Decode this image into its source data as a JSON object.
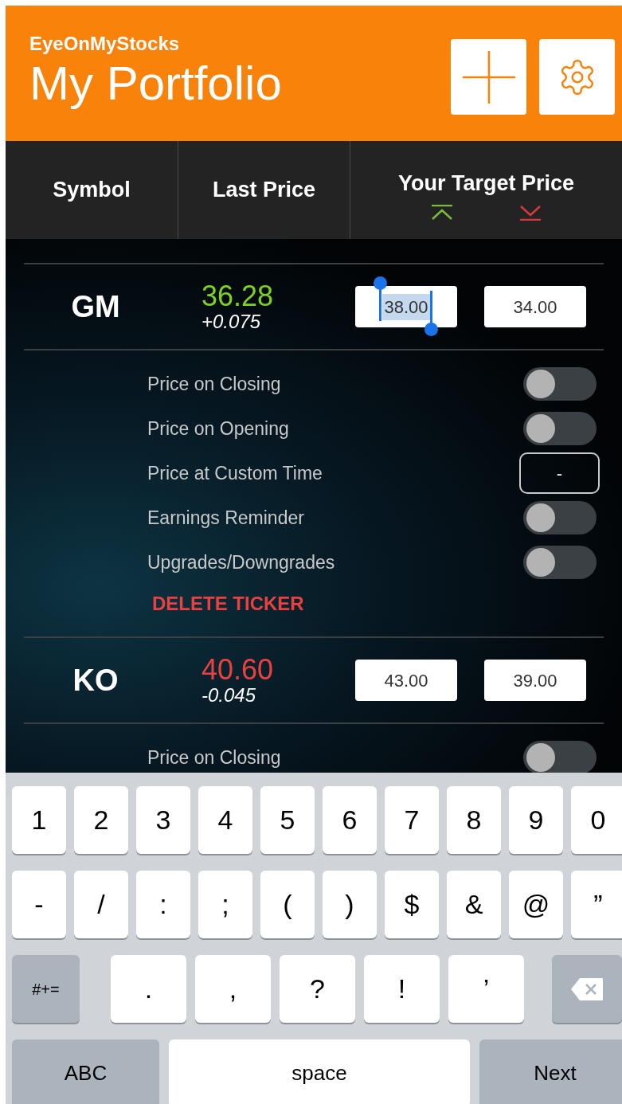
{
  "header": {
    "app_name": "EyeOnMyStocks",
    "title": "My Portfolio"
  },
  "columns": [
    {
      "label": "Symbol"
    },
    {
      "label": "Last Price"
    },
    {
      "label": "Your Target Price"
    }
  ],
  "stocks": [
    {
      "symbol": "GM",
      "price": "36.28",
      "change": "+0.075",
      "color": "#7ed321",
      "targets": [
        {
          "value": "38.00",
          "selected": true
        },
        {
          "value": "34.00",
          "selected": false
        }
      ],
      "options": [
        {
          "kind": "toggle",
          "label": "Price on Closing",
          "on": false
        },
        {
          "kind": "toggle",
          "label": "Price on Opening",
          "on": false
        },
        {
          "kind": "time",
          "label": "Price at Custom Time",
          "value": "-"
        },
        {
          "kind": "toggle",
          "label": "Earnings Reminder",
          "on": false
        },
        {
          "kind": "toggle",
          "label": "Upgrades/Downgrades",
          "on": false
        }
      ],
      "delete_label": "DELETE TICKER"
    },
    {
      "symbol": "KO",
      "price": "40.60",
      "change": "-0.045",
      "color": "#e8413f",
      "targets": [
        {
          "value": "43.00",
          "selected": false
        },
        {
          "value": "39.00",
          "selected": false
        }
      ],
      "options": [
        {
          "kind": "toggle",
          "label": "Price on Closing",
          "on": false
        }
      ]
    }
  ],
  "keyboard": {
    "number_keys": [
      {
        "kind": "char",
        "label": "1"
      },
      {
        "kind": "char",
        "label": "2"
      },
      {
        "kind": "char",
        "label": "3"
      },
      {
        "kind": "char",
        "label": "4"
      },
      {
        "kind": "char",
        "label": "5"
      },
      {
        "kind": "char",
        "label": "6"
      },
      {
        "kind": "char",
        "label": "7"
      },
      {
        "kind": "char",
        "label": "8"
      },
      {
        "kind": "char",
        "label": "9"
      },
      {
        "kind": "char",
        "label": "0"
      }
    ],
    "symbol_keys": [
      {
        "kind": "char",
        "label": "-"
      },
      {
        "kind": "char",
        "label": "/"
      },
      {
        "kind": "char",
        "label": ":"
      },
      {
        "kind": "char",
        "label": ";"
      },
      {
        "kind": "char",
        "label": "("
      },
      {
        "kind": "char",
        "label": ")"
      },
      {
        "kind": "char",
        "label": "$"
      },
      {
        "kind": "char",
        "label": "&"
      },
      {
        "kind": "char",
        "label": "@"
      },
      {
        "kind": "char",
        "label": "”"
      }
    ],
    "punctuation_keys": [
      {
        "kind": "mode",
        "label": "#+="
      },
      {
        "kind": "punct",
        "label": "."
      },
      {
        "kind": "punct",
        "label": ","
      },
      {
        "kind": "punct",
        "label": "?"
      },
      {
        "kind": "punct",
        "label": "!"
      },
      {
        "kind": "punct",
        "label": "’"
      },
      {
        "kind": "delete"
      }
    ],
    "bottom_keys": [
      {
        "kind": "abc",
        "label": "ABC"
      },
      {
        "kind": "space",
        "label": "space"
      },
      {
        "kind": "next",
        "label": "Next"
      }
    ]
  }
}
